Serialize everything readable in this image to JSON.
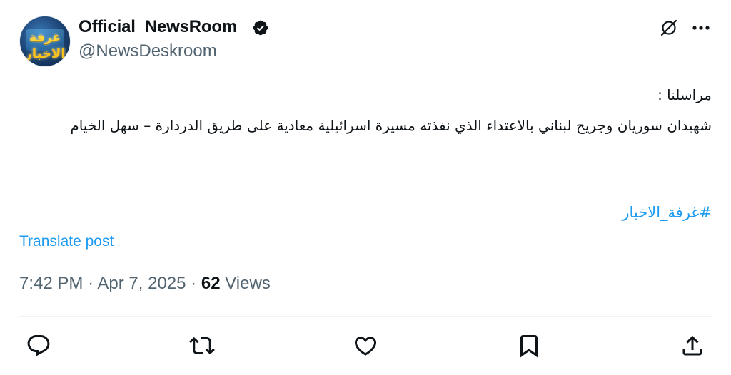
{
  "author": {
    "display_name": "Official_NewsRoom",
    "handle": "@NewsDeskroom",
    "avatar_logo_line1": "غرفة",
    "avatar_logo_line2": "الاخبار",
    "verified_icon": "verified-badge-icon"
  },
  "post": {
    "line1": "مراسلنا :",
    "line2": "شهيدان سوريان وجريح لبناني بالاعتداء الذي نفذته مسيرة اسرائيلية معادية على طريق الدردارة – سهل الخيام",
    "hashtag": "#غرفة_الاخبار",
    "translate_label": "Translate post"
  },
  "meta": {
    "time": "7:42 PM",
    "date": "Apr 7, 2025",
    "views_count": "62",
    "views_label": "Views"
  },
  "actions": {
    "reply_icon": "reply-icon",
    "repost_icon": "repost-icon",
    "like_icon": "like-icon",
    "bookmark_icon": "bookmark-icon",
    "share_icon": "share-icon"
  },
  "colors": {
    "accent": "#1d9bf0",
    "secondary_text": "#536471",
    "primary_text": "#0f1419",
    "divider": "#eff3f4"
  }
}
